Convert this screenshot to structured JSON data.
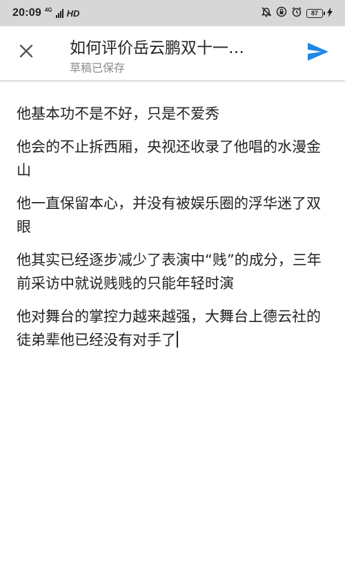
{
  "status_bar": {
    "time": "20:09",
    "network": "4G",
    "hd": "HD",
    "battery": "87"
  },
  "header": {
    "title": "如何评价岳云鹏双十一…",
    "subtitle": "草稿已保存",
    "accent_color": "#1e88e5"
  },
  "editor": {
    "paragraphs": [
      "他基本功不是不好，只是不爱秀",
      "他会的不止拆西厢，央视还收录了他唱的水漫金山",
      "他一直保留本心，并没有被娱乐圈的浮华迷了双眼",
      "他其实已经逐步减少了表演中“贱”的成分，三年前采访中就说贱贱的只能年轻时演",
      "他对舞台的掌控力越来越强，大舞台上德云社的徒弟辈他已经没有对手了"
    ]
  }
}
